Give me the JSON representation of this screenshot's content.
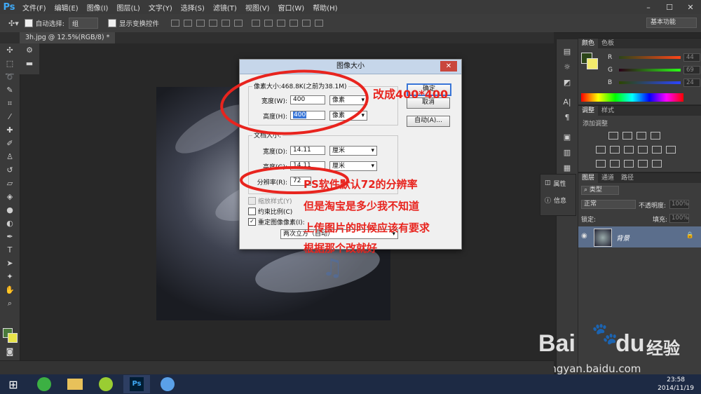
{
  "app": {
    "logo": "Ps"
  },
  "menu": [
    "文件(F)",
    "编辑(E)",
    "图像(I)",
    "图层(L)",
    "文字(Y)",
    "选择(S)",
    "滤镜(T)",
    "视图(V)",
    "窗口(W)",
    "帮助(H)"
  ],
  "window_controls": {
    "minimize": "–",
    "maximize": "☐",
    "close": "✕"
  },
  "options": {
    "auto_select_label": "自动选择:",
    "auto_select_value": "组",
    "show_transform_label": "显示变换控件",
    "workspace": "基本功能"
  },
  "document_tab": "3h.jpg @ 12.5%(RGB/8) *",
  "dialog": {
    "title": "图像大小",
    "close": "✕",
    "pixel_dimensions_label": "像素大小:468.8K(之前为38.1M)",
    "width_label": "宽度(W):",
    "width_value": "400",
    "width_unit": "像素",
    "height_label": "高度(H):",
    "height_value": "400",
    "height_unit": "像素",
    "document_size_label": "文档大小:",
    "doc_width_label": "宽度(D):",
    "doc_width_value": "14.11",
    "doc_width_unit": "厘米",
    "doc_height_label": "高度(G):",
    "doc_height_value": "14.11",
    "doc_height_unit": "厘米",
    "resolution_label": "分辨率(R):",
    "resolution_value": "72",
    "scale_styles_label": "缩放样式(Y)",
    "constrain_label": "约束比例(C)",
    "resample_label": "重定图像像素(I):",
    "resample_method": "两次立方（自动）",
    "ok_button": "确定",
    "cancel_button": "取消",
    "auto_button": "自动(A)..."
  },
  "annotations": {
    "note1": "改成400*400",
    "note2": "PS软件默认72的分辨率",
    "note3": "但是淘宝是多少我不知道",
    "note4": "上传图片的时候应该有要求",
    "note5": "根据那个改就好"
  },
  "color_panel": {
    "tabs": [
      "颜色",
      "色板"
    ],
    "sliders": [
      {
        "letter": "R",
        "value": "44",
        "color": "#e04a3a"
      },
      {
        "letter": "G",
        "value": "69",
        "color": "#3ab04a"
      },
      {
        "letter": "B",
        "value": "24",
        "color": "#3a5ae0"
      }
    ]
  },
  "adjust_panel": {
    "tabs": [
      "调整",
      "样式"
    ],
    "add_label": "添加调整"
  },
  "float_panel": {
    "properties": "属性",
    "info": "信息"
  },
  "layers_panel": {
    "tabs": [
      "图层",
      "通道",
      "路径"
    ],
    "kind_label": "类型",
    "blend_mode": "正常",
    "opacity_label": "不透明度:",
    "opacity_value": "100%",
    "lock_label": "锁定:",
    "fill_label": "填充:",
    "fill_value": "100%",
    "layer_name": "背景"
  },
  "watermark": {
    "brand": "Bai",
    "brand2": "du",
    "brand_cn": "经验",
    "url": "jingyan.baidu.com"
  },
  "taskbar": {
    "time": "23:58",
    "date": "2014/11/19"
  }
}
